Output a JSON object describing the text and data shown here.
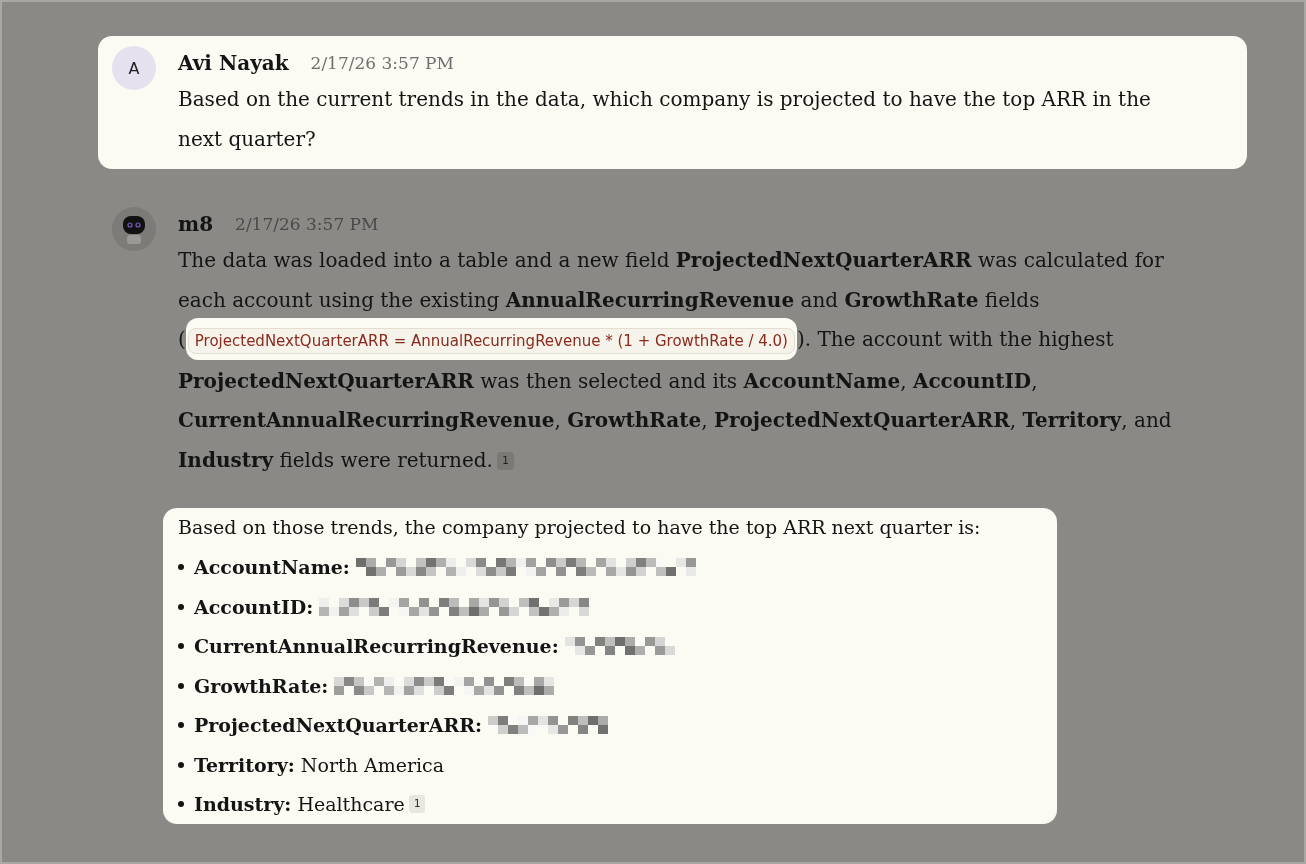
{
  "messages": [
    {
      "kind": "user",
      "avatar": "A",
      "author": "Avi Nayak",
      "time": "2/17/26 3:57 PM",
      "highlighted": true,
      "text": "Based on the current trends in the data, which company is projected to have the top ARR in the next quarter?"
    },
    {
      "kind": "bot",
      "author": "m8",
      "time": "2/17/26 3:57 PM",
      "highlighted": false,
      "before": "The data was loaded into a table and a new field **ProjectedNextQuarterARR** was calculated for each account using the existing **AnnualRecurringRevenue** and **GrowthRate** fields (",
      "code": "ProjectedNextQuarterARR = AnnualRecurringRevenue * (1 + GrowthRate / 4.0)",
      "after": "). The account with the highest **ProjectedNextQuarterARR** was then selected and its **AccountName**, **AccountID**, **CurrentAnnualRecurringRevenue**, **GrowthRate**, **ProjectedNextQuarterARR**, **Territory**, and **Industry** fields were returned.",
      "citation": "1",
      "answer": {
        "highlighted": true,
        "intro": "Based on those trends, the company projected to have the top ARR next quarter is:",
        "items": [
          {
            "label": "AccountName:",
            "redacted": true
          },
          {
            "label": "AccountID:",
            "redacted": true
          },
          {
            "label": "CurrentAnnualRecurringRevenue:",
            "redacted": true
          },
          {
            "label": "GrowthRate:",
            "redacted": true
          },
          {
            "label": "ProjectedNextQuarterARR:",
            "redacted": true
          },
          {
            "label": "Territory:",
            "redacted": false,
            "value": "North America"
          },
          {
            "label": "Industry:",
            "redacted": false,
            "value": "Healthcare",
            "citation": "1"
          }
        ]
      }
    }
  ]
}
